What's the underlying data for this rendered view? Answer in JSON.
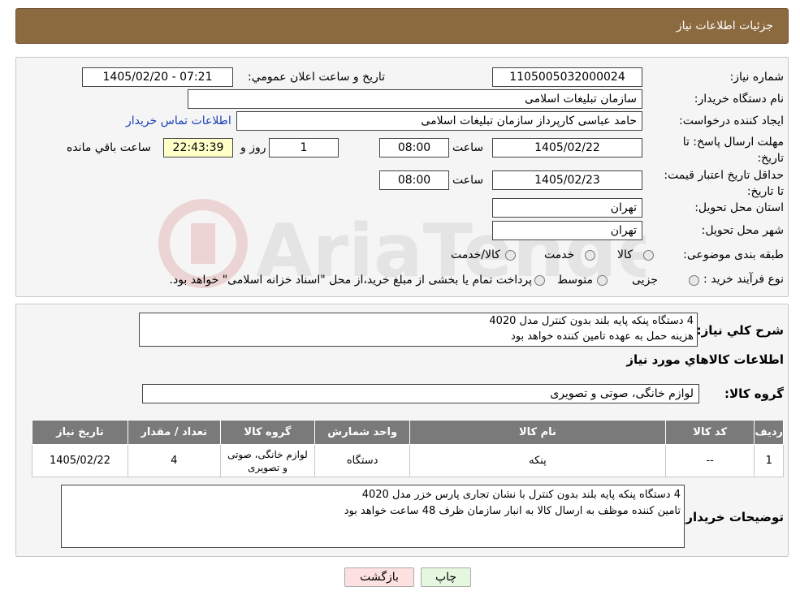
{
  "header": {
    "title": "جزئيات اطلاعات نياز"
  },
  "form": {
    "need_number_label": "شماره نیاز:",
    "need_number": "1105005032000024",
    "announce_label": "تاريخ و ساعت اعلان عمومي:",
    "announce_value": "1405/02/20 - 07:21",
    "buyer_org_label": "نام دستگاه خریدار:",
    "buyer_org": "سازمان تبلیغات اسلامی",
    "requester_label": "ایجاد کننده درخواست:",
    "requester": "حامد عباسی کارپرداز سازمان تبلیغات اسلامی",
    "contact_link": "اطلاعات تماس خریدار",
    "deadline_label": "مهلت ارسال پاسخ: تا تاریخ:",
    "deadline_date": "1405/02/22",
    "time_label": "ساعت",
    "deadline_time": "08:00",
    "days_value": "1",
    "days_label": "روز و",
    "remaining_time": "22:43:39",
    "remaining_label": "ساعت باقي مانده",
    "validity_label": "حداقل تاريخ اعتبار قيمت: تا تاریخ:",
    "validity_date": "1405/02/23",
    "validity_time": "08:00",
    "province_label": "استان محل تحویل:",
    "province": "تهران",
    "city_label": "شهر محل تحویل:",
    "city": "تهران",
    "category_label": "طبقه بندی موضوعی:",
    "category_options": [
      "کالا",
      "خدمت",
      "کالا/خدمت"
    ],
    "process_label": "نوع فرآیند خرید :",
    "process_options": [
      "جزیی",
      "متوسط"
    ],
    "process_note": "پرداخت تمام یا بخشی از مبلغ خرید،از محل \"اسناد خزانه اسلامی\" خواهد بود."
  },
  "summary": {
    "label": "شرح کلي نياز:",
    "text_line1": "4 دستگاه پنکه پایه بلند بدون کنترل مدل 4020",
    "text_line2": "هزینه حمل به عهده تامین کننده خواهد بود",
    "goods_info_title": "اطلاعات کالاهاي مورد نياز",
    "goods_group_label": "گروه کالا:",
    "goods_group": "لوازم خانگی، صوتی و تصویری"
  },
  "table": {
    "headers": [
      "رديف",
      "کد کالا",
      "نام کالا",
      "واحد شمارش",
      "گروه کالا",
      "تعداد / مقدار",
      "تاريخ نياز"
    ],
    "rows": [
      [
        "1",
        "--",
        "پنکه",
        "دستگاه",
        "لوازم خانگی، صوتی و تصویری",
        "4",
        "1405/02/22"
      ]
    ]
  },
  "buyer_notes": {
    "label": "توضیحات خریدار:",
    "line1": "4 دستگاه پنکه پایه بلند  بدون کنترل با نشان تجاری  پارس خزر مدل 4020",
    "line2": "تامین کننده موظف به ارسال کالا به انبار سازمان ظرف 48 ساعت خواهد بود"
  },
  "buttons": {
    "print": "چاپ",
    "back": "بازگشت"
  },
  "colors": {
    "header": "#8c6a40",
    "table_header": "#7a7a7a",
    "back_button": "#fde0e0",
    "print_button": "#e6f7e0"
  }
}
